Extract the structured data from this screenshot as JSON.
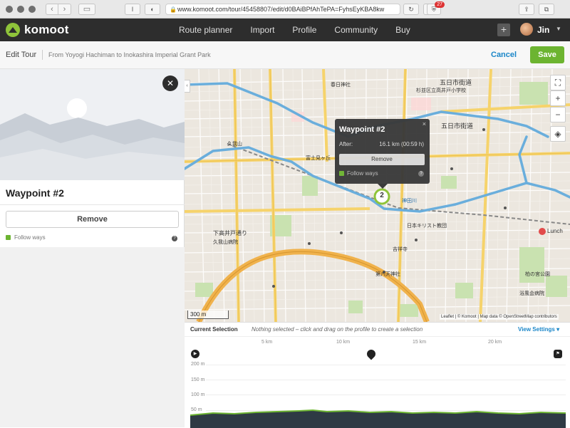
{
  "browser": {
    "url": "www.komoot.com/tour/45458807/edit/d0BAiBPfAhTePA=FyhsEyKBA8kw",
    "ext_badge": "27",
    "reader": "I"
  },
  "header": {
    "logo": "komoot",
    "nav": [
      "Route planner",
      "Import",
      "Profile",
      "Community",
      "Buy"
    ],
    "user": "Jin"
  },
  "editbar": {
    "title": "Edit Tour",
    "tour_name": "From Yoyogi Hachiman to Inokashira Imperial Grant Park",
    "cancel": "Cancel",
    "save": "Save"
  },
  "panel": {
    "waypoint_title": "Waypoint #2",
    "remove": "Remove",
    "follow_ways": "Follow ways",
    "help": "?"
  },
  "popup": {
    "title": "Waypoint #2",
    "after_label": "After:",
    "after_value": "16.1 km (00:59 h)",
    "remove": "Remove",
    "follow_ways": "Follow ways",
    "close": "×"
  },
  "map": {
    "waypoint_number": "2",
    "scale": "300 m",
    "attribution": "Leaflet | © Komoot | Map data © OpenStreetMap contributors",
    "lunch_label": "Lunch",
    "labels": [
      "五日市街道",
      "五日市街道",
      "Lunch",
      "下高井戸通り",
      "久我山病院",
      "春日神社",
      "杉並区立高井戸小学校",
      "日本キリスト教団",
      "吉祥寺",
      "第六天神社",
      "富士見ヶ丘",
      "久我山",
      "神田川",
      "柏の宮公園",
      "浴風会病院"
    ]
  },
  "elevation": {
    "current_selection": "Current Selection",
    "nothing_selected": "Nothing selected – click and drag on the profile to create a selection",
    "view_settings": "View Settings",
    "km_labels": [
      "5 km",
      "10 km",
      "15 km",
      "20 km"
    ],
    "y_labels": [
      "200 m",
      "150 m",
      "100 m",
      "50 m"
    ]
  },
  "colors": {
    "brand_green": "#6cb431",
    "link_blue": "#1a86c8",
    "header_dark": "#2d2d2d",
    "route_blue": "#6aaedc",
    "road_yellow": "#f6d36b",
    "road_orange": "#f0b24c"
  }
}
